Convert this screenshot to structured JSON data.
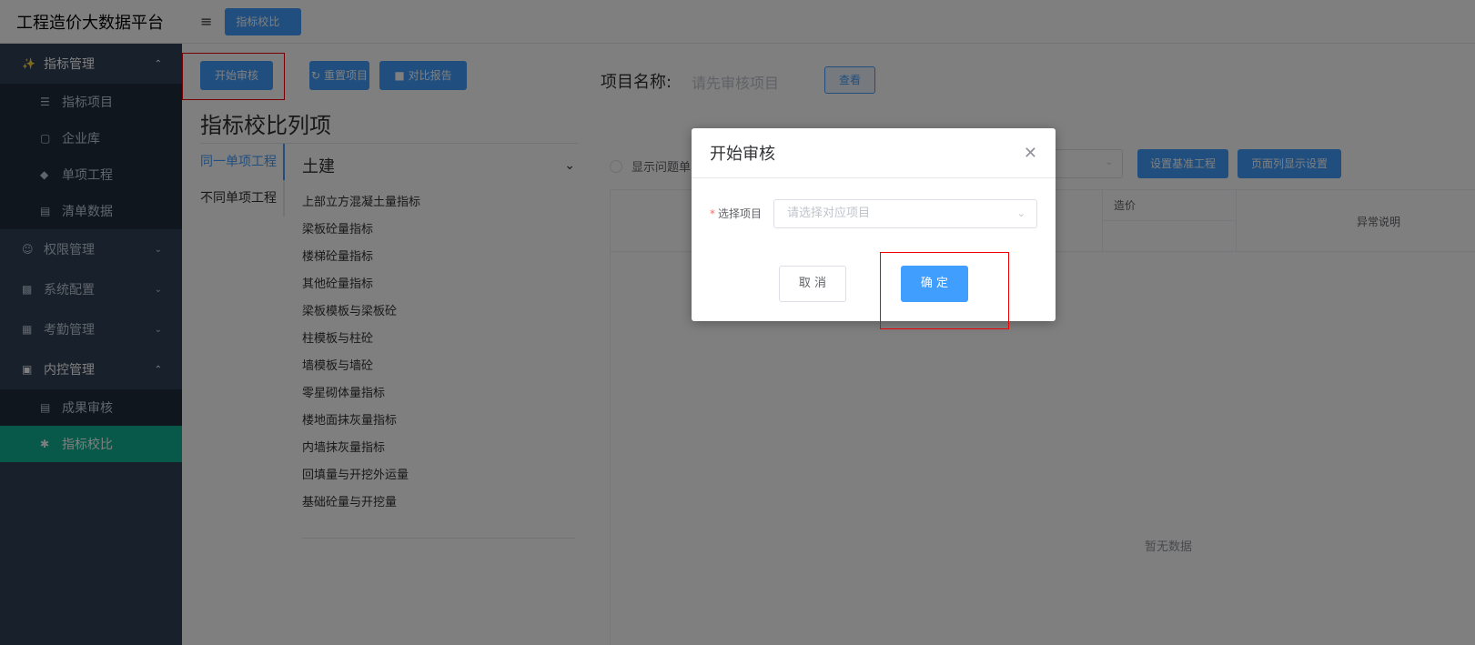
{
  "header": {
    "brand": "工程造价大数据平台",
    "active_tab": "指标校比"
  },
  "sidebar": {
    "groups": [
      {
        "label": "指标管理",
        "icon": "chart-icon",
        "open": true,
        "items": [
          {
            "label": "指标项目",
            "icon": "layers-icon"
          },
          {
            "label": "企业库",
            "icon": "cube-icon"
          },
          {
            "label": "单项工程",
            "icon": "stack-icon"
          },
          {
            "label": "清单数据",
            "icon": "clipboard-icon"
          }
        ]
      },
      {
        "label": "权限管理",
        "icon": "user-lock-icon",
        "open": false
      },
      {
        "label": "系统配置",
        "icon": "config-icon",
        "open": false
      },
      {
        "label": "考勤管理",
        "icon": "calendar-icon",
        "open": false
      },
      {
        "label": "内控管理",
        "icon": "control-icon",
        "open": true,
        "items": [
          {
            "label": "成果审核",
            "icon": "document-icon"
          },
          {
            "label": "指标校比",
            "icon": "compare-icon",
            "active": true
          }
        ]
      }
    ]
  },
  "toolbar": {
    "start_audit": "开始审核",
    "reset_project": "重置项目",
    "compare_report": "对比报告"
  },
  "project": {
    "label": "项目名称:",
    "placeholder": "请先审核项目",
    "view_button": "查看"
  },
  "list_title": "指标校比列项",
  "vertical_tabs": [
    "同一单项工程",
    "不同单项工程"
  ],
  "collapse": {
    "title": "土建",
    "items": [
      "上部立方混凝土量指标",
      "梁板砼量指标",
      "楼梯砼量指标",
      "其他砼量指标",
      "梁板模板与梁板砼",
      "柱模板与柱砼",
      "墙模板与墙砼",
      "零星砌体量指标",
      "楼地面抹灰量指标",
      "内墙抹灰量指标",
      "回填量与开挖外运量",
      "基础砼量与开挖量"
    ]
  },
  "filters": {
    "show_problem_label": "显示问题单",
    "set_baseline": "设置基准工程",
    "column_settings": "页面列显示设置"
  },
  "table": {
    "col_cost": "造价",
    "col_abnormal": "异常说明",
    "empty_text": "暂无数据"
  },
  "dialog": {
    "title": "开始审核",
    "field_label": "选择项目",
    "field_placeholder": "请选择对应项目",
    "cancel": "取 消",
    "confirm": "确 定"
  },
  "colors": {
    "primary": "#409eff",
    "sidebar_bg": "#304156",
    "sidebar_active": "#13b394",
    "highlight_box": "#e00000"
  }
}
